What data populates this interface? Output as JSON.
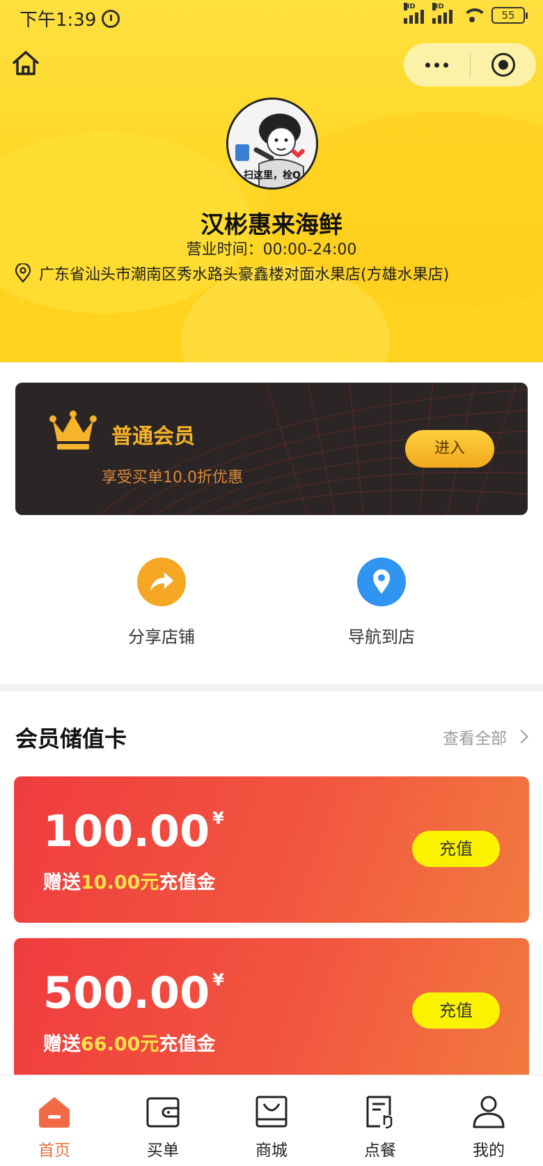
{
  "status_bar": {
    "time": "下午1:39",
    "battery": "55",
    "network_1": "HD",
    "network_2": "HD"
  },
  "store": {
    "avatar_caption": "扫这里，栓Q",
    "name": "汉彬惠来海鲜",
    "hours": "营业时间：00:00-24:00",
    "address": "广东省汕头市潮南区秀水路头豪鑫楼对面水果店(方雄水果店)"
  },
  "member": {
    "title": "普通会员",
    "desc": "享受买单10.0折优惠",
    "enter_label": "进入"
  },
  "actions": [
    {
      "label": "分享店铺",
      "icon": "share-arrow-icon",
      "color": "#f5a623"
    },
    {
      "label": "导航到店",
      "icon": "location-pin-icon",
      "color": "#2f95f0"
    }
  ],
  "cards_section": {
    "title": "会员储值卡",
    "view_all": "查看全部"
  },
  "cards": [
    {
      "amount": "100.00",
      "currency": "¥",
      "gift_prefix": "赠送",
      "gift_amount": "10.00元",
      "gift_suffix": "充值金",
      "button": "充值"
    },
    {
      "amount": "500.00",
      "currency": "¥",
      "gift_prefix": "赠送",
      "gift_amount": "66.00元",
      "gift_suffix": "充值金",
      "button": "充值"
    }
  ],
  "tabbar": [
    {
      "label": "首页",
      "icon": "home-icon",
      "active": true
    },
    {
      "label": "买单",
      "icon": "wallet-icon",
      "active": false
    },
    {
      "label": "商城",
      "icon": "shop-bag-icon",
      "active": false
    },
    {
      "label": "点餐",
      "icon": "order-menu-icon",
      "active": false
    },
    {
      "label": "我的",
      "icon": "user-icon",
      "active": false
    }
  ],
  "colors": {
    "header_yellow": "#ffd92a",
    "member_bg": "#2c2526",
    "member_gold": "#f6b42a",
    "card_red": "#ef3c3e",
    "charge_yellow": "#fbf200",
    "active_tab": "#e8703a"
  }
}
